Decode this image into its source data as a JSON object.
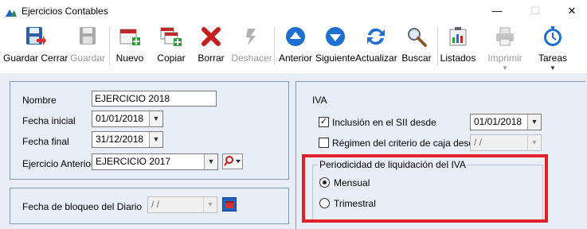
{
  "window": {
    "title": "Ejercicios Contables",
    "minimize": "—",
    "maximize": "☐",
    "close": "✕"
  },
  "toolbar": {
    "buttons": [
      {
        "label": "Guardar Cerrar",
        "icon": "save-close-icon"
      },
      {
        "label": "Guardar",
        "icon": "save-icon"
      },
      {
        "label": "Nuevo",
        "icon": "new-icon"
      },
      {
        "label": "Copiar",
        "icon": "copy-icon"
      },
      {
        "label": "Borrar",
        "icon": "delete-icon"
      },
      {
        "label": "Deshacer",
        "icon": "undo-icon"
      },
      {
        "label": "Anterior",
        "icon": "arrow-up-icon"
      },
      {
        "label": "Siguiente",
        "icon": "arrow-down-icon"
      },
      {
        "label": "Actualizar",
        "icon": "refresh-icon"
      },
      {
        "label": "Buscar",
        "icon": "search-icon"
      },
      {
        "label": "Listados",
        "icon": "reports-icon"
      },
      {
        "label": "Imprimir",
        "icon": "printer-icon"
      },
      {
        "label": "Tareas",
        "icon": "tasks-icon"
      }
    ],
    "dropdown_arrow": "▼"
  },
  "form": {
    "nombre_label": "Nombre",
    "nombre_value": "EJERCICIO 2018",
    "fecha_inicial_label": "Fecha inicial",
    "fecha_inicial_value": "01/01/2018",
    "fecha_final_label": "Fecha final",
    "fecha_final_value": "31/12/2018",
    "ejercicio_anterior_label": "Ejercicio Anterior",
    "ejercicio_anterior_value": "EJERCICIO 2017",
    "bloqueo_label": "Fecha de bloqueo del Diario",
    "bloqueo_value": " /  /"
  },
  "iva": {
    "title": "IVA",
    "sii_label": "Inclusión en el SII desde",
    "sii_checked": "✓",
    "sii_value": "01/01/2018",
    "caja_label": "Régimen del criterio de caja desde",
    "caja_value": " /  /",
    "periodicidad_legend": "Periodicidad de liquidación del IVA",
    "mensual_label": "Mensual",
    "trimestral_label": "Trimestral",
    "selected": "Mensual",
    "highlight_color": "#e0202a"
  },
  "colors": {
    "panel_bg": "#e9eef6",
    "accent_blue": "#1f63c6"
  }
}
